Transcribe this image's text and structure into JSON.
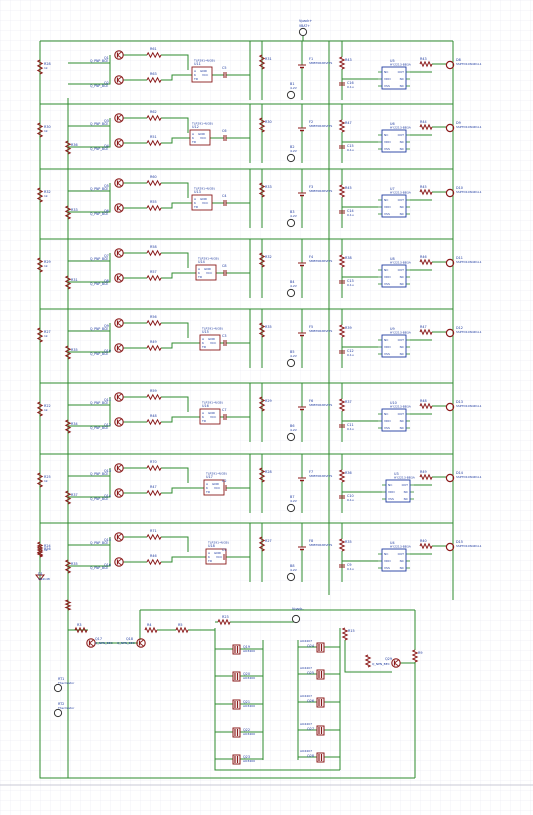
{
  "colors": {
    "wire": "#2e8b2e",
    "resistor": "#8b1a1a",
    "ic": "#1e3a9f",
    "label": "#1e3a9f",
    "grid": "#e4e4ef",
    "bg": "#ffffff"
  },
  "top_port": {
    "label": "Vpack+",
    "sub": "VBAT+"
  },
  "bottom_port": "Vpack-",
  "left_resistors": [
    "R28",
    "R30",
    "R32",
    "R29",
    "R27",
    "R22",
    "R25",
    "R24"
  ],
  "left_res_value": "1k",
  "left_mid_resistors": [
    "",
    "R36",
    "R33",
    "R31",
    "R35",
    "R34",
    "R37",
    "R35"
  ],
  "left_bottom": {
    "zener": "D1",
    "zener_part": "1N4148",
    "res": "R56"
  },
  "input_resistors_a": [
    "R61",
    "R62",
    "R60",
    "R58",
    "R56",
    "R59",
    "R70",
    "R71"
  ],
  "input_resistors_b": [
    "R63",
    "R51",
    "R55",
    "R57",
    "R49",
    "R48",
    "R47",
    "R46"
  ],
  "mosfet_part": "Q_PNP_BCE",
  "mosfet_labels_a": [
    "Q1",
    "Q3",
    "Q5",
    "Q7",
    "Q9",
    "Q11",
    "Q13",
    "Q15"
  ],
  "mosfet_labels_b": [
    "Q2",
    "Q4",
    "Q6",
    "Q8",
    "Q10",
    "Q12",
    "Q14",
    "Q16"
  ],
  "opto_labels": [
    "U11",
    "U12",
    "U13",
    "U14",
    "U15",
    "U16",
    "U17",
    "U18"
  ],
  "opto_part": "TLP291-4(GB)",
  "opto_pins": [
    "A",
    "GND",
    "K",
    "VCC",
    "TD"
  ],
  "caps_mid": [
    "C5",
    "C6",
    "C4",
    "C8",
    "C3",
    "C7",
    "C2",
    "C1"
  ],
  "res_vert_mid": [
    "R31",
    "R30",
    "R33",
    "R32",
    "R35",
    "R29",
    "R28",
    "R27"
  ],
  "fuses": [
    "F1",
    "F2",
    "F3",
    "F4",
    "F5",
    "F6",
    "F7",
    "F8"
  ],
  "fuse_part": "SMBT0RXRVIVS",
  "taps": [
    "B1",
    "B2",
    "B3",
    "B4",
    "B5",
    "B6",
    "B7",
    "B8"
  ],
  "tap_sub": "4.2V",
  "right_res": [
    "R43",
    "R47",
    "R45",
    "R38",
    "R39",
    "R37",
    "R36",
    "R35"
  ],
  "right_caps": [
    "C16",
    "C15",
    "C14",
    "C13",
    "C12",
    "C11",
    "C10",
    "C9"
  ],
  "cap_value": "0.1u",
  "right_ic_labels": [
    "U5",
    "U6",
    "U7",
    "U8",
    "U9",
    "U10",
    "U3",
    "U4"
  ],
  "right_ic_part": "HY2213-BB3A",
  "right_ic_pins_left": [
    "NC",
    "VDD",
    "VSS"
  ],
  "right_ic_pins_right": [
    "OUT",
    "NC",
    "NC"
  ],
  "out_res": [
    "R43",
    "R44",
    "R45",
    "R46",
    "R47",
    "R48",
    "R49",
    "R40"
  ],
  "out_res_value": "470",
  "out_fets": [
    "D8",
    "D9",
    "D10",
    "D11",
    "D12",
    "D13",
    "D14",
    "D15"
  ],
  "out_fet_part": "SSPTD10N4D1L1",
  "bottom": {
    "q_left": [
      "Q17",
      "Q18"
    ],
    "q_left_part": "Q_NPN_BEC",
    "res_row": [
      "R3",
      "R4",
      "R5",
      "R2"
    ],
    "rt": [
      "RT1",
      "RT2"
    ],
    "rt_part": "Thermistor",
    "fet_col1": [
      "Q19",
      "Q20",
      "Q21",
      "Q22",
      "Q23"
    ],
    "fet_col2": [
      "Q24",
      "Q25",
      "Q26",
      "Q27",
      "Q28"
    ],
    "fet_part": "AO3400",
    "fet_part2": "AO4407",
    "r_top": "R23",
    "r_right": "R15",
    "q_out": "Q29",
    "q_out_part": "Q_NPN_BEC",
    "r_far": "R9"
  }
}
